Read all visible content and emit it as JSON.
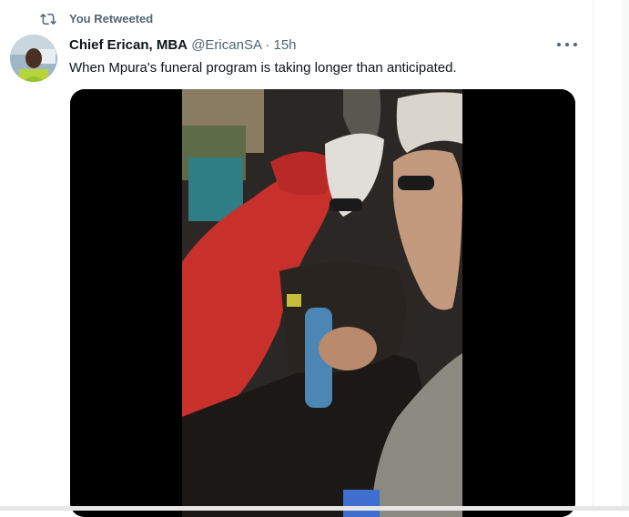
{
  "retweet": {
    "label": "You Retweeted",
    "icon": "retweet-icon"
  },
  "tweet": {
    "author_name": "Chief Erican, MBA",
    "handle": "@EricanSA",
    "separator": "·",
    "timestamp": "15h",
    "text": "When Mpura's funeral program is taking longer than anticipated.",
    "more_icon": "more-icon"
  },
  "colors": {
    "secondary_text": "#536471",
    "primary_text": "#0f1419",
    "media_background": "#000000"
  }
}
